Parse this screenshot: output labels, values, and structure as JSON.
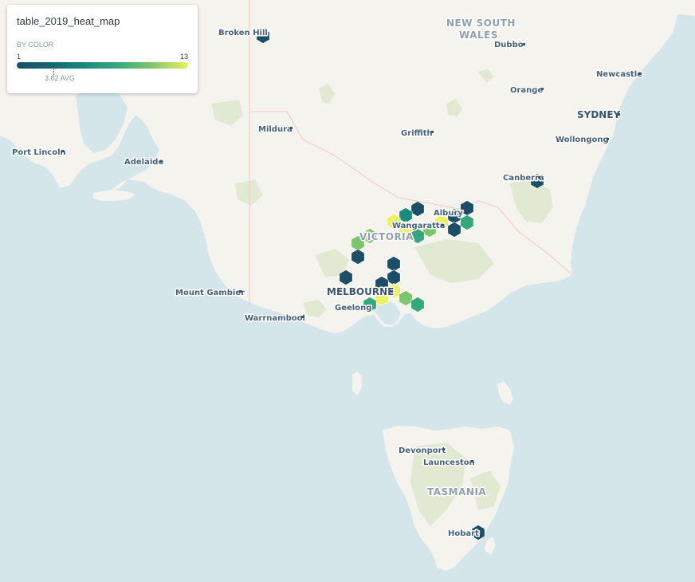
{
  "legend": {
    "title": "table_2019_heat_map",
    "subtitle": "BY COLOR",
    "min": "1",
    "max": "13",
    "avg_label": "3.62 AVG",
    "ramp": [
      "#1d4e68",
      "#18626f",
      "#1b8a81",
      "#35a77d",
      "#7cc46d",
      "#e9f261"
    ]
  },
  "colors": {
    "water": "#d4e6e9",
    "land": "#f5f3ee",
    "park": "#dfe8cf",
    "border": "#f1c9c4"
  },
  "places": {
    "broken_hill": "Broken Hill",
    "nsw_line1": "NEW SOUTH",
    "nsw_line2": "WALES",
    "dubbo": "Dubbo",
    "newcastle": "Newcastle",
    "orange": "Orange",
    "sydney": "SYDNEY",
    "mildura": "Mildura",
    "griffith": "Griffith",
    "wollongong": "Wollongong",
    "port_lincoln": "Port Lincoln",
    "adelaide": "Adelaide",
    "canberra": "Canberra",
    "albury": "Albury",
    "wangaratta": "Wangaratta",
    "victoria": "VICTORIA",
    "mount_gambier": "Mount Gambier",
    "melbourne": "MELBOURNE",
    "geelong": "Geelong",
    "warrnambool": "Warrnambool",
    "devonport": "Devonport",
    "launceston": "Launceston",
    "tasmania": "TASMANIA",
    "hobart": "Hobart"
  }
}
